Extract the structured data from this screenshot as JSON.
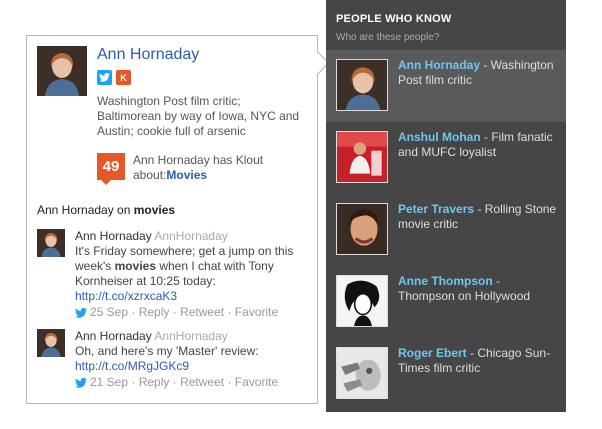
{
  "profile": {
    "name": "Ann Hornaday",
    "bio": "Washington Post film critic; Baltimorean by way of Iowa, NYC and Austin; cookie full of arsenic",
    "klout_score": "49",
    "klout_text": "Ann Hornaday has Klout about:",
    "klout_topic": "Movies"
  },
  "section": {
    "prefix": "Ann Hornaday on ",
    "topic": "movies"
  },
  "tweets": [
    {
      "author": "Ann Hornaday",
      "handle": "AnnHornaday",
      "text_before": "It's Friday somewhere; get a jump on this week's ",
      "text_bold": "movies",
      "text_after": " when I chat with Tony Kornheiser at 10:25 today: ",
      "link": "http://t.co/xzrxcaK3",
      "date": "25 Sep",
      "reply": "Reply",
      "retweet": "Retweet",
      "favorite": "Favorite"
    },
    {
      "author": "Ann Hornaday",
      "handle": "AnnHornaday",
      "text_before": "Oh, and here's my 'Master' review: ",
      "text_bold": "",
      "text_after": "",
      "link": "http://t.co/MRgJGKc9",
      "date": "21 Sep",
      "reply": "Reply",
      "retweet": "Retweet",
      "favorite": "Favorite"
    }
  ],
  "panel": {
    "title": "PEOPLE WHO KNOW",
    "subtitle": "Who are these people?",
    "people": [
      {
        "name": "Ann Hornaday",
        "desc": " - Washington Post film critic"
      },
      {
        "name": "Anshul Mohan",
        "desc": " - Film fanatic and MUFC loyalist"
      },
      {
        "name": "Peter Travers",
        "desc": " - Rolling Stone movie critic"
      },
      {
        "name": "Anne Thompson",
        "desc": " - Thompson on Hollywood"
      },
      {
        "name": "Roger Ebert",
        "desc": " - Chicago Sun-Times film critic"
      }
    ]
  },
  "colors": {
    "link": "#2a5db0",
    "klout": "#e5582a",
    "twitter": "#1da1f2",
    "panel_bg": "#464646",
    "panel_name": "#6cc7f0"
  }
}
